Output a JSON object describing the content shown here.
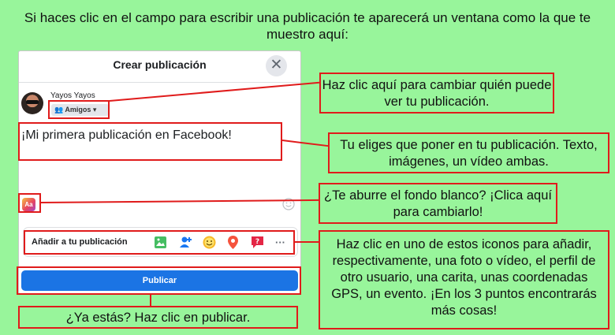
{
  "intro": "Si haces clic en el campo para escribir una publicación te aparecerá un ventana como la que te muestro aquí:",
  "dialog": {
    "title": "Crear publicación",
    "close_glyph": "✕",
    "user_name": "Yayos Yayos",
    "audience_label": "Amigos",
    "post_text": "¡Mi primera publicación en Facebook!",
    "background_button": "Aa",
    "add_to_post": "Añadir a tu publicación",
    "more_glyph": "···",
    "publish_label": "Publicar"
  },
  "icons": [
    "photo-icon",
    "tag-people-icon",
    "feeling-icon",
    "location-icon",
    "event-icon",
    "more-icon",
    "emoji-icon",
    "close-icon",
    "people-icon",
    "caret-down-icon"
  ],
  "callouts": {
    "audience": "Haz clic aquí para cambiar quién puede ver tu publicación.",
    "text": "Tu eliges que poner en tu publicación. Texto, imágenes, un vídeo ambas.",
    "background": "¿Te aburre el fondo blanco? ¡Clica aquí para cambiarlo!",
    "icons": "Haz clic en uno de estos iconos para añadir, respectivamente, una foto o vídeo, el perfil de otro usuario, una carita, unas coordenadas GPS, un evento. ¡En los 3 puntos encontrarás más cosas!",
    "publish": "¿Ya estás? Haz clic en publicar."
  },
  "colors": {
    "background": "#98f59b",
    "highlight": "#e01b1b",
    "facebook_blue": "#1b74e4"
  }
}
